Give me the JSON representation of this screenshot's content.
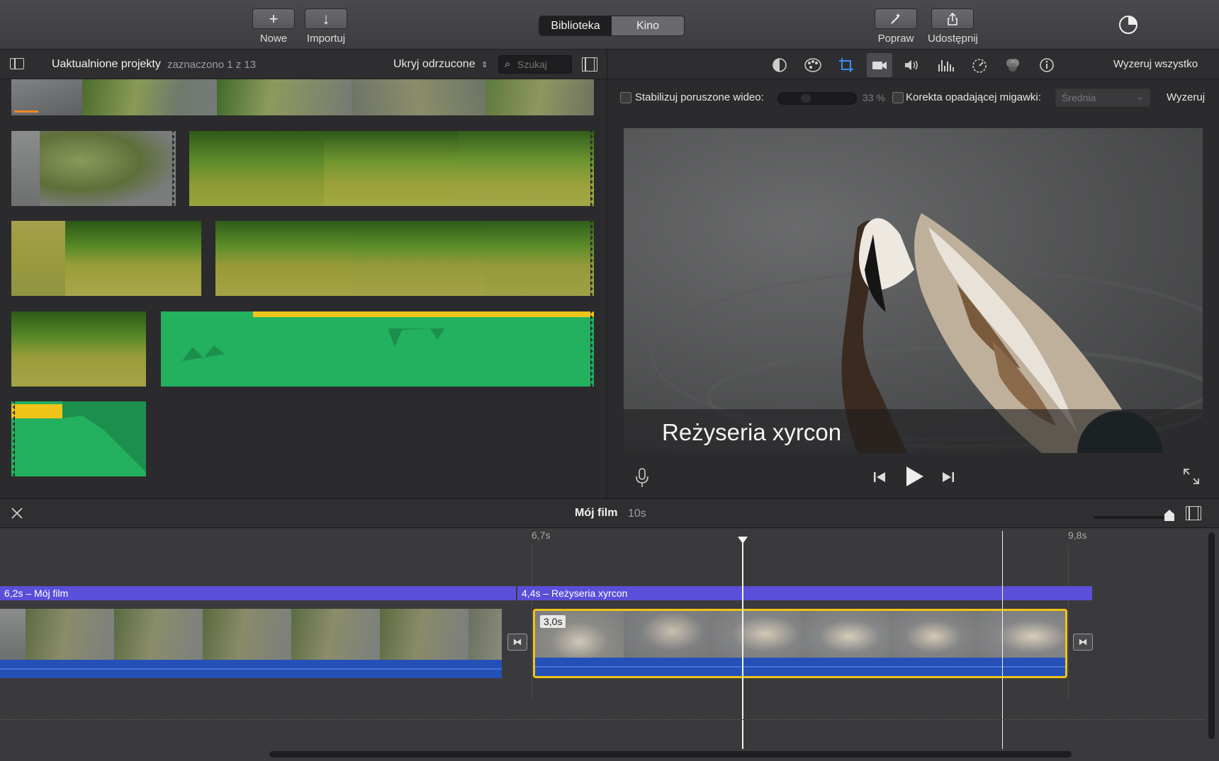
{
  "toolbar": {
    "new_label": "Nowe",
    "import_label": "Importuj",
    "segment_library": "Biblioteka",
    "segment_theater": "Kino",
    "enhance_label": "Popraw",
    "share_label": "Udostępnij"
  },
  "library": {
    "title": "Uaktualnione projekty",
    "selection": "zaznaczono 1 z 13",
    "filter": "Ukryj odrzucone",
    "search_placeholder": "Szukaj"
  },
  "viewer": {
    "reset_all": "Wyzeruj wszystko",
    "stabilize_label": "Stabilizuj poruszone wideo:",
    "stabilize_percent": "33 %",
    "rolling_shutter_label": "Korekta opadającej migawki:",
    "rolling_shutter_value": "Średnia",
    "reset": "Wyzeruj",
    "title_overlay": "Reżyseria xyrcon"
  },
  "timeline": {
    "project_title": "Mój film",
    "project_duration": "10s",
    "marker_left": "6,7s",
    "marker_right": "9,8s",
    "clip1_title": "6,2s – Mój film",
    "clip2_title": "4,4s –  Reżyseria xyrcon",
    "selected_duration": "3,0s"
  },
  "colors": {
    "accent_title": "#5b4fd9",
    "selection": "#f0c419",
    "audio": "#2450b8",
    "audio_green": "#23b05f"
  }
}
